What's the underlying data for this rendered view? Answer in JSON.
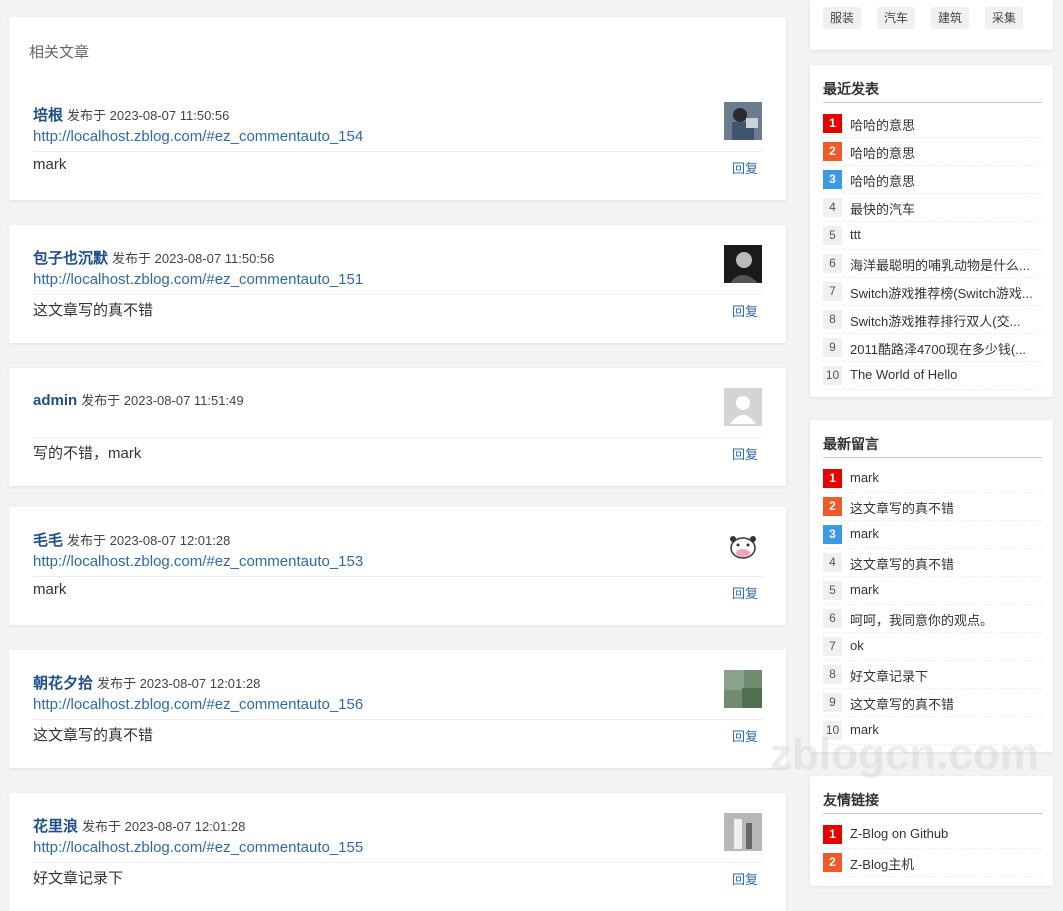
{
  "related": {
    "title": "相关文章"
  },
  "comments": [
    {
      "author": "培根",
      "meta": "发布于 2023-08-07 11:50:56",
      "url": "http://localhost.zblog.com/#ez_commentauto_154",
      "text": "mark",
      "reply": "回复",
      "avatar": "photo"
    },
    {
      "author": "包子也沉默",
      "meta": "发布于 2023-08-07 11:50:56",
      "url": "http://localhost.zblog.com/#ez_commentauto_151",
      "text": "这文章写的真不错",
      "reply": "回复",
      "avatar": "dark"
    },
    {
      "author": "admin",
      "meta": "发布于 2023-08-07 11:51:49",
      "url": "",
      "text": "写的不错，mark",
      "reply": "回复",
      "avatar": "default"
    },
    {
      "author": "毛毛",
      "meta": "发布于 2023-08-07 12:01:28",
      "url": "http://localhost.zblog.com/#ez_commentauto_153",
      "text": "mark",
      "reply": "回复",
      "avatar": "cow"
    },
    {
      "author": "朝花夕拾",
      "meta": "发布于 2023-08-07 12:01:28",
      "url": "http://localhost.zblog.com/#ez_commentauto_156",
      "text": "这文章写的真不错",
      "reply": "回复",
      "avatar": "green"
    },
    {
      "author": "花里浪",
      "meta": "发布于 2023-08-07 12:01:28",
      "url": "http://localhost.zblog.com/#ez_commentauto_155",
      "text": "好文章记录下",
      "reply": "回复",
      "avatar": "grey"
    }
  ],
  "tags": [
    "服装",
    "汽车",
    "建筑",
    "采集"
  ],
  "recent": {
    "title": "最近发表",
    "items": [
      "哈哈的意思",
      "哈哈的意思",
      "哈哈的意思",
      "最快的汽车",
      "ttt",
      "海洋最聪明的哺乳动物是什么...",
      "Switch游戏推荐榜(Switch游戏...",
      "Switch游戏推荐排行双人(交...",
      "2011酷路泽4700现在多少钱(...",
      "The World of Hello"
    ]
  },
  "latest_comments": {
    "title": "最新留言",
    "items": [
      "mark",
      "这文章写的真不错",
      "mark",
      "这文章写的真不错",
      "mark",
      "呵呵，我同意你的观点。",
      "ok",
      "好文章记录下",
      "这文章写的真不错",
      "mark"
    ]
  },
  "links": {
    "title": "友情链接",
    "items": [
      "Z-Blog on Github",
      "Z-Blog主机"
    ]
  },
  "watermark": "zblogcn.com"
}
